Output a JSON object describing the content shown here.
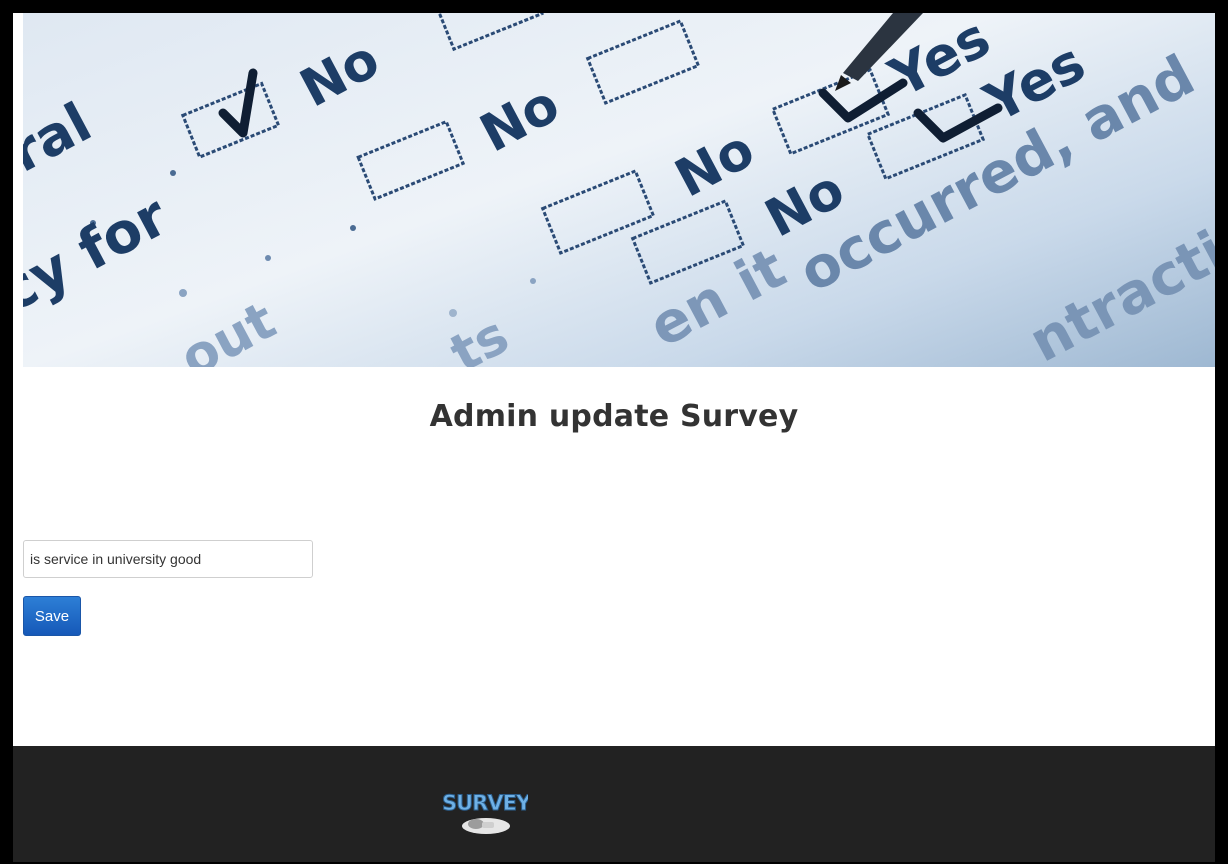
{
  "banner": {
    "alt": "survey checklist image",
    "words": {
      "no_1": "No",
      "no_2": "No",
      "no_3": "No",
      "no_4": "No",
      "yes_1": "Yes",
      "yes_2": "Yes",
      "frag_ral": "ral",
      "frag_cy_for": "cy for",
      "frag_occurred": "occurred, and",
      "frag_when_it": "en it",
      "frag_out": "out",
      "frag_ts": "ts",
      "frag_ntractio": "ntractio"
    }
  },
  "page": {
    "title": "Admin update Survey"
  },
  "form": {
    "question_value": "is service in university good",
    "save_label": "Save"
  },
  "footer": {
    "logo_text": "SURVEY"
  }
}
